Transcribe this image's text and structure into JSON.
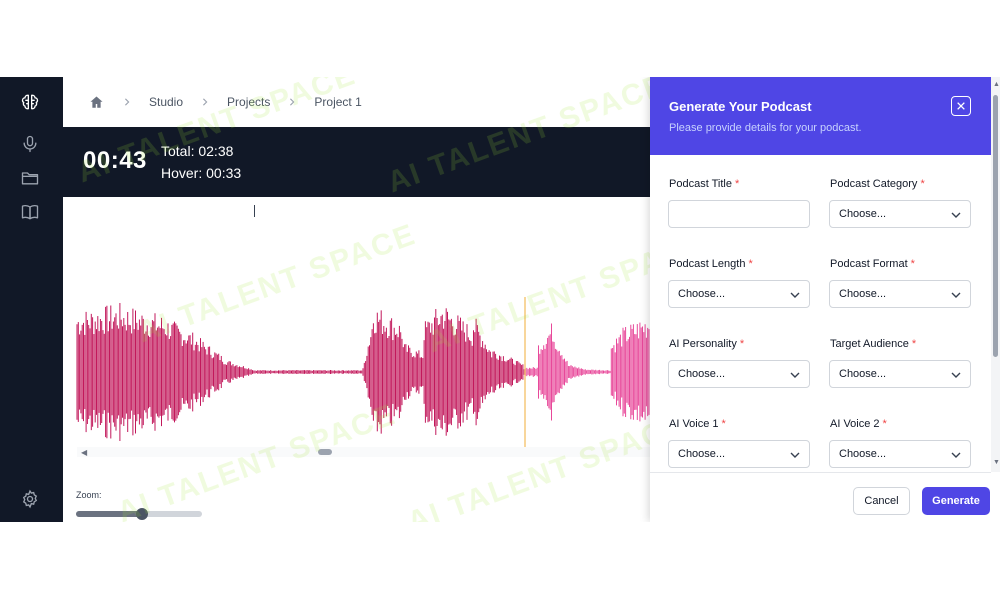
{
  "breadcrumb": {
    "items": [
      "Studio",
      "Projects",
      "Project 1"
    ]
  },
  "player": {
    "current_time": "00:43",
    "total_label": "Total: 02:38",
    "hover_label": "Hover: 00:33",
    "zoom_label": "Zoom:",
    "zoom_level": 0.52,
    "scroll_position": 0.42,
    "wave_color": "#c2185b",
    "wave_played_color": "#e8489a",
    "playhead_color": "#f5c87a"
  },
  "watermark": "AI TALENT SPACE",
  "modal": {
    "title": "Generate Your Podcast",
    "subtitle": "Please provide details for your podcast.",
    "required_mark": "*",
    "fields": {
      "podcast_title": {
        "label": "Podcast Title",
        "value": "",
        "placeholder": ""
      },
      "podcast_category": {
        "label": "Podcast Category",
        "value": "Choose..."
      },
      "podcast_length": {
        "label": "Podcast Length",
        "value": "Choose..."
      },
      "podcast_format": {
        "label": "Podcast Format",
        "value": "Choose..."
      },
      "ai_personality": {
        "label": "AI Personality",
        "value": "Choose..."
      },
      "target_audience": {
        "label": "Target Audience",
        "value": "Choose..."
      },
      "ai_voice_1": {
        "label": "AI Voice 1",
        "value": "Choose..."
      },
      "ai_voice_2": {
        "label": "AI Voice 2",
        "value": "Choose..."
      }
    },
    "cancel_label": "Cancel",
    "generate_label": "Generate",
    "accent": "#4f46e5"
  },
  "colors": {
    "sidebar": "#111827",
    "timebar": "#111827"
  }
}
